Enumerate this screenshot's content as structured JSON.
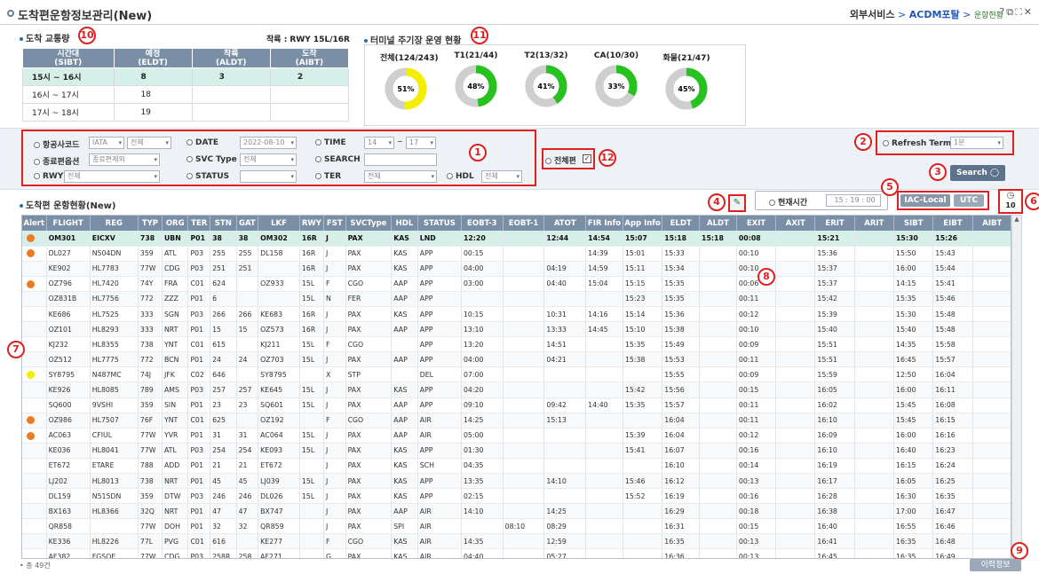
{
  "window": {
    "title": "도착편운항정보관리(New)",
    "breadcrumb": [
      "외부서비스",
      "ACDM포탈",
      "운항현황"
    ]
  },
  "arrival_traffic": {
    "title": "도착 교통량",
    "runway_info": "착륙 : RWY  15L/16R",
    "headers": [
      "시간대\n(SIBT)",
      "예정\n(ELDT)",
      "착륙\n(ALDT)",
      "도착\n(AIBT)"
    ],
    "rows": [
      [
        "15시 ~ 16시",
        "8",
        "3",
        "2"
      ],
      [
        "16시 ~ 17시",
        "18",
        "",
        ""
      ],
      [
        "17시 ~ 18시",
        "19",
        "",
        ""
      ]
    ]
  },
  "terminal_parking": {
    "title": "터미널 주기장 운영 현황",
    "items": [
      {
        "label": "전체(124/243)",
        "percent": 51,
        "color": "#f4ee00"
      },
      {
        "label": "T1(21/44)",
        "percent": 48,
        "color": "#27c21f"
      },
      {
        "label": "T2(13/32)",
        "percent": 41,
        "color": "#27c21f"
      },
      {
        "label": "CA(10/30)",
        "percent": 33,
        "color": "#27c21f"
      },
      {
        "label": "화물(21/47)",
        "percent": 45,
        "color": "#27c21f"
      }
    ]
  },
  "filters": {
    "airline": {
      "label": "항공사코드",
      "type": "IATA",
      "value": "전체"
    },
    "date": {
      "label": "DATE",
      "value": "2022-08-10"
    },
    "time": {
      "label": "TIME",
      "from": "14",
      "sep": "~",
      "to": "17"
    },
    "route": {
      "label": "종료편옵션",
      "value": "종료편제외"
    },
    "svc_type": {
      "label": "SVC Type",
      "value": "전체"
    },
    "search": {
      "label": "SEARCH",
      "value": ""
    },
    "rwy": {
      "label": "RWY",
      "value": "전체"
    },
    "status": {
      "label": "STATUS",
      "value": ""
    },
    "ter": {
      "label": "TER",
      "value": "전체"
    },
    "hdl": {
      "label": "HDL",
      "value": "전체"
    },
    "all_flights": {
      "label": "전체편"
    },
    "refresh": {
      "label": "Refresh Term",
      "value": "1분"
    },
    "search_button": "Search"
  },
  "grid": {
    "title": "도착편 운항현황(New)",
    "current_time_label": "현재시간",
    "current_time": "15 : 19 : 00",
    "btn_local": "IAC-Local",
    "btn_utc": "UTC",
    "count": "10",
    "total": "• 총 49건",
    "history_button": "이력정보",
    "columns": [
      "Alert",
      "FLIGHT",
      "REG",
      "TYP",
      "ORG",
      "TER",
      "STN",
      "GAT",
      "LKF",
      "RWY",
      "FST",
      "SVCType",
      "HDL",
      "STATUS",
      "EOBT-3",
      "EOBT-1",
      "ATOT",
      "FIR Info",
      "App Info",
      "ELDT",
      "ALDT",
      "EXIT",
      "AXIT",
      "ERIT",
      "ARIT",
      "SIBT",
      "EIBT",
      "AIBT"
    ],
    "rows": [
      [
        "orange",
        "OM301",
        "EICXV",
        "738",
        "UBN",
        "P01",
        "38",
        "38",
        "OM302",
        "16R",
        "J",
        "PAX",
        "KAS",
        "LND",
        "12:20",
        "",
        "12:44",
        "14:54",
        "15:07",
        "15:18",
        "15:18",
        "00:08",
        "",
        "15:21",
        "",
        "15:30",
        "15:26",
        ""
      ],
      [
        "orange",
        "DL027",
        "N504DN",
        "359",
        "ATL",
        "P03",
        "255",
        "255",
        "DL158",
        "16R",
        "J",
        "PAX",
        "KAS",
        "APP",
        "00:15",
        "",
        "",
        "14:39",
        "15:01",
        "15:33",
        "",
        "00:10",
        "",
        "15:36",
        "",
        "15:50",
        "15:43",
        ""
      ],
      [
        "",
        "KE902",
        "HL7783",
        "77W",
        "CDG",
        "P03",
        "251",
        "251",
        "",
        "16R",
        "J",
        "PAX",
        "KAS",
        "APP",
        "04:00",
        "",
        "04:19",
        "14:59",
        "15:11",
        "15:34",
        "",
        "00:10",
        "",
        "15:37",
        "",
        "16:00",
        "15:44",
        ""
      ],
      [
        "orange",
        "OZ796",
        "HL7420",
        "74Y",
        "FRA",
        "C01",
        "624",
        "",
        "OZ933",
        "15L",
        "F",
        "CGO",
        "AAP",
        "APP",
        "03:00",
        "",
        "04:40",
        "15:04",
        "15:15",
        "15:35",
        "",
        "00:06",
        "",
        "15:37",
        "",
        "14:15",
        "15:41",
        ""
      ],
      [
        "",
        "OZ831B",
        "HL7756",
        "772",
        "ZZZ",
        "P01",
        "6",
        "",
        "",
        "15L",
        "N",
        "FER",
        "AAP",
        "APP",
        "",
        "",
        "",
        "",
        "15:23",
        "15:35",
        "",
        "00:11",
        "",
        "15:42",
        "",
        "15:35",
        "15:46",
        ""
      ],
      [
        "",
        "KE686",
        "HL7525",
        "333",
        "SGN",
        "P03",
        "266",
        "266",
        "KE683",
        "16R",
        "J",
        "PAX",
        "KAS",
        "APP",
        "10:15",
        "",
        "10:31",
        "14:16",
        "15:14",
        "15:36",
        "",
        "00:12",
        "",
        "15:39",
        "",
        "15:30",
        "15:48",
        ""
      ],
      [
        "",
        "OZ101",
        "HL8293",
        "333",
        "NRT",
        "P01",
        "15",
        "15",
        "OZ573",
        "16R",
        "J",
        "PAX",
        "AAP",
        "APP",
        "13:10",
        "",
        "13:33",
        "14:45",
        "15:10",
        "15:38",
        "",
        "00:10",
        "",
        "15:40",
        "",
        "15:40",
        "15:48",
        ""
      ],
      [
        "",
        "KJ232",
        "HL8355",
        "738",
        "YNT",
        "C01",
        "615",
        "",
        "KJ211",
        "15L",
        "F",
        "CGO",
        "",
        "APP",
        "13:20",
        "",
        "14:51",
        "",
        "15:35",
        "15:49",
        "",
        "00:09",
        "",
        "15:51",
        "",
        "14:35",
        "15:58",
        ""
      ],
      [
        "",
        "OZ512",
        "HL7775",
        "772",
        "BCN",
        "P01",
        "24",
        "24",
        "OZ703",
        "15L",
        "J",
        "PAX",
        "AAP",
        "APP",
        "04:00",
        "",
        "04:21",
        "",
        "15:38",
        "15:53",
        "",
        "00:11",
        "",
        "15:51",
        "",
        "16:45",
        "15:57",
        ""
      ],
      [
        "yellow",
        "SY8795",
        "N487MC",
        "74J",
        "JFK",
        "C02",
        "646",
        "",
        "SY8795",
        "",
        "X",
        "STP",
        "",
        "DEL",
        "07:00",
        "",
        "",
        "",
        "",
        "15:55",
        "",
        "00:09",
        "",
        "15:59",
        "",
        "12:50",
        "16:04",
        ""
      ],
      [
        "",
        "KE926",
        "HL8085",
        "789",
        "AMS",
        "P03",
        "257",
        "257",
        "KE645",
        "15L",
        "J",
        "PAX",
        "KAS",
        "APP",
        "04:20",
        "",
        "",
        "",
        "15:42",
        "15:56",
        "",
        "00:15",
        "",
        "16:05",
        "",
        "16:00",
        "16:11",
        ""
      ],
      [
        "",
        "SQ600",
        "9VSHI",
        "359",
        "SIN",
        "P01",
        "23",
        "23",
        "SQ601",
        "15L",
        "J",
        "PAX",
        "AAP",
        "APP",
        "09:10",
        "",
        "09:42",
        "14:40",
        "15:35",
        "15:57",
        "",
        "00:11",
        "",
        "16:02",
        "",
        "15:45",
        "16:08",
        ""
      ],
      [
        "orange",
        "OZ986",
        "HL7507",
        "76F",
        "YNT",
        "C01",
        "625",
        "",
        "OZ192",
        "",
        "F",
        "CGO",
        "AAP",
        "AIR",
        "14:25",
        "",
        "15:13",
        "",
        "",
        "16:04",
        "",
        "00:11",
        "",
        "16:10",
        "",
        "15:45",
        "16:15",
        ""
      ],
      [
        "orange",
        "AC063",
        "CFIUL",
        "77W",
        "YVR",
        "P01",
        "31",
        "31",
        "AC064",
        "15L",
        "J",
        "PAX",
        "AAP",
        "AIR",
        "05:00",
        "",
        "",
        "",
        "15:39",
        "16:04",
        "",
        "00:12",
        "",
        "16:09",
        "",
        "16:00",
        "16:16",
        ""
      ],
      [
        "",
        "KE036",
        "HL8041",
        "77W",
        "ATL",
        "P03",
        "254",
        "254",
        "KE093",
        "15L",
        "J",
        "PAX",
        "KAS",
        "APP",
        "01:30",
        "",
        "",
        "",
        "15:41",
        "16:07",
        "",
        "00:16",
        "",
        "16:10",
        "",
        "16:40",
        "16:23",
        ""
      ],
      [
        "",
        "ET672",
        "ETARE",
        "788",
        "ADD",
        "P01",
        "21",
        "21",
        "ET672",
        "",
        "J",
        "PAX",
        "KAS",
        "SCH",
        "04:35",
        "",
        "",
        "",
        "",
        "16:10",
        "",
        "00:14",
        "",
        "16:19",
        "",
        "16:15",
        "16:24",
        ""
      ],
      [
        "",
        "LJ202",
        "HL8013",
        "738",
        "NRT",
        "P01",
        "45",
        "45",
        "LJ039",
        "15L",
        "J",
        "PAX",
        "KAS",
        "APP",
        "13:35",
        "",
        "14:10",
        "",
        "15:46",
        "16:12",
        "",
        "00:13",
        "",
        "16:17",
        "",
        "16:05",
        "16:25",
        ""
      ],
      [
        "",
        "DL159",
        "N515DN",
        "359",
        "DTW",
        "P03",
        "246",
        "246",
        "DL026",
        "15L",
        "J",
        "PAX",
        "KAS",
        "APP",
        "02:15",
        "",
        "",
        "",
        "15:52",
        "16:19",
        "",
        "00:16",
        "",
        "16:28",
        "",
        "16:30",
        "16:35",
        ""
      ],
      [
        "",
        "BX163",
        "HL8366",
        "32Q",
        "NRT",
        "P01",
        "47",
        "47",
        "BX747",
        "",
        "J",
        "PAX",
        "AAP",
        "AIR",
        "14:10",
        "",
        "14:25",
        "",
        "",
        "16:29",
        "",
        "00:18",
        "",
        "16:38",
        "",
        "17:00",
        "16:47",
        ""
      ],
      [
        "",
        "QR858",
        "",
        "77W",
        "DOH",
        "P01",
        "32",
        "32",
        "QR859",
        "",
        "J",
        "PAX",
        "SPI",
        "AIR",
        "",
        "08:10",
        "08:29",
        "",
        "",
        "16:31",
        "",
        "00:15",
        "",
        "16:40",
        "",
        "16:55",
        "16:46",
        ""
      ],
      [
        "",
        "KE336",
        "HL8226",
        "77L",
        "PVG",
        "C01",
        "616",
        "",
        "KE277",
        "",
        "F",
        "CGO",
        "KAS",
        "AIR",
        "14:35",
        "",
        "12:59",
        "",
        "",
        "16:35",
        "",
        "00:13",
        "",
        "16:41",
        "",
        "16:35",
        "16:48",
        ""
      ],
      [
        "",
        "AF382",
        "FGSQE",
        "77W",
        "CDG",
        "P03",
        "258R",
        "258",
        "AF271",
        "",
        "G",
        "PAX",
        "KAS",
        "AIR",
        "04:40",
        "",
        "05:27",
        "",
        "",
        "16:36",
        "",
        "00:13",
        "",
        "16:45",
        "",
        "16:35",
        "16:49",
        ""
      ]
    ]
  },
  "annotations": [
    "1",
    "2",
    "3",
    "4",
    "5",
    "6",
    "7",
    "8",
    "9",
    "10",
    "11",
    "12"
  ],
  "colors": {
    "header": "#7a8fa6",
    "highlight": "#d7efe9",
    "alert_orange": "#ec7b22",
    "alert_yellow": "#f4ee00",
    "annotation": "#e02020"
  }
}
